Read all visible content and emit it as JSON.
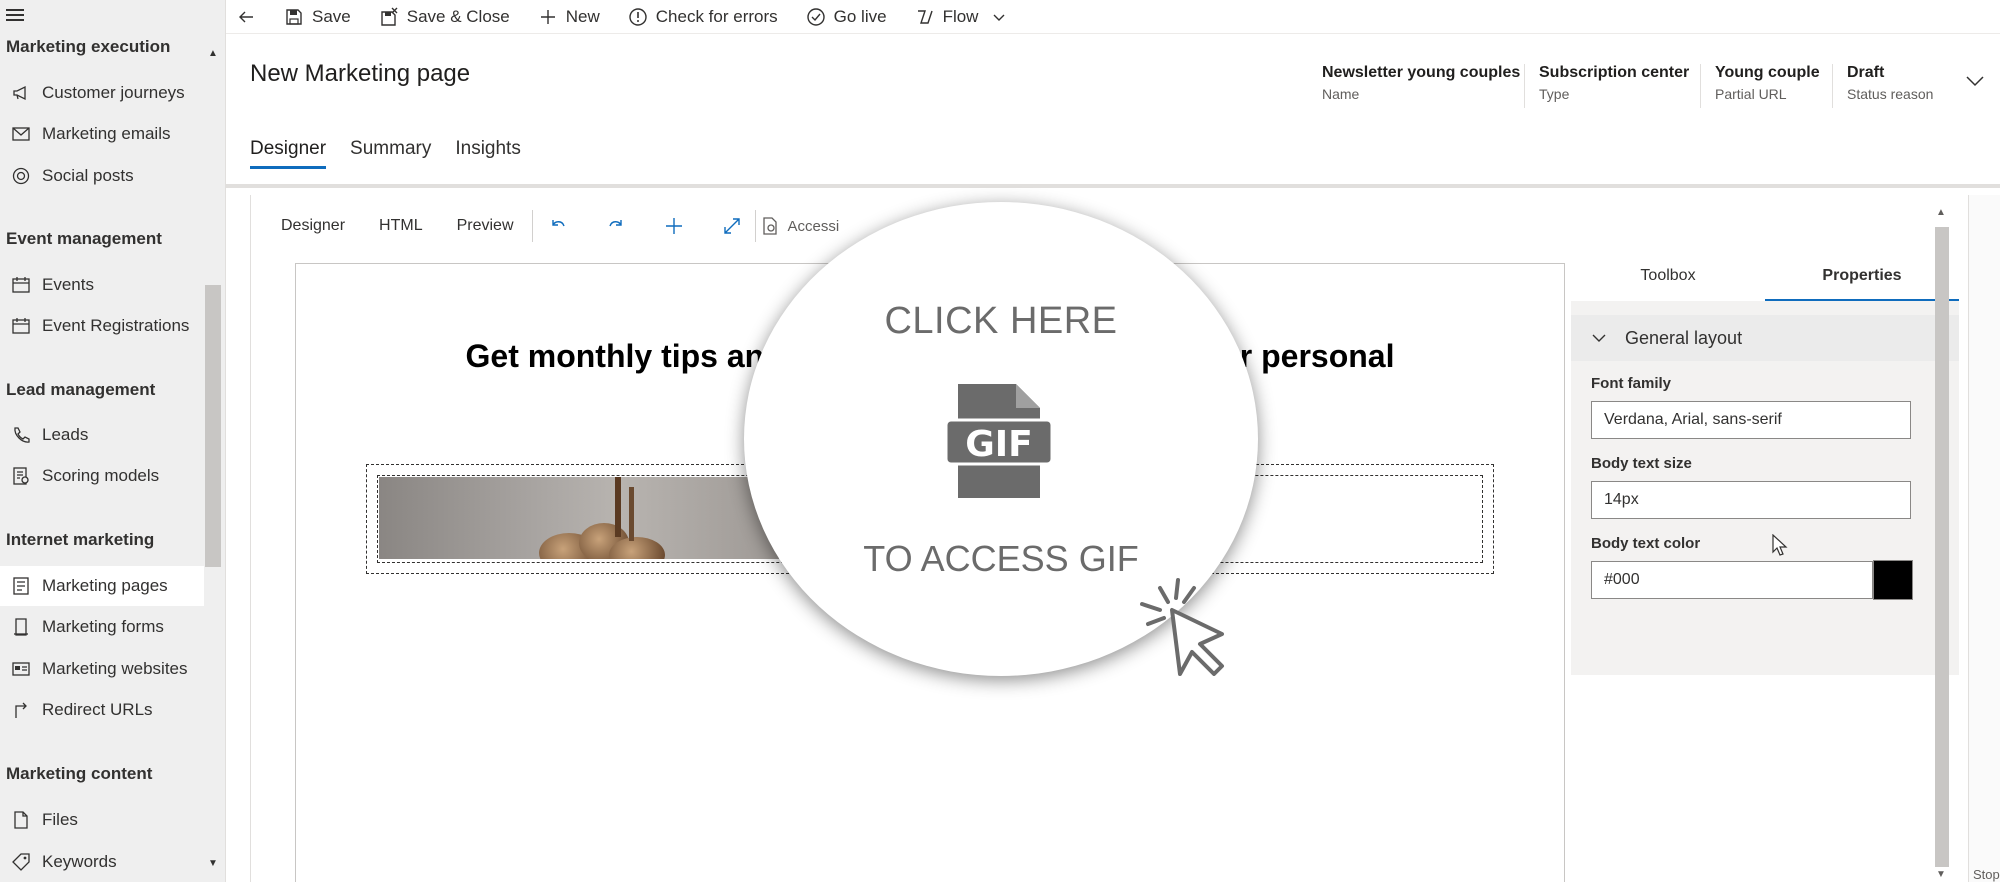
{
  "sidebar": {
    "groups": [
      {
        "title": "Marketing execution"
      },
      {
        "title": "Event management"
      },
      {
        "title": "Lead management"
      },
      {
        "title": "Internet marketing"
      },
      {
        "title": "Marketing content"
      }
    ],
    "items": [
      {
        "label": "Customer journeys",
        "icon": "megaphone-icon"
      },
      {
        "label": "Marketing emails",
        "icon": "mail-icon"
      },
      {
        "label": "Social posts",
        "icon": "social-icon"
      },
      {
        "label": "Events",
        "icon": "calendar-icon"
      },
      {
        "label": "Event Registrations",
        "icon": "calendar-icon"
      },
      {
        "label": "Leads",
        "icon": "phone-icon"
      },
      {
        "label": "Scoring models",
        "icon": "scoring-icon"
      },
      {
        "label": "Marketing pages",
        "icon": "page-icon"
      },
      {
        "label": "Marketing forms",
        "icon": "form-icon"
      },
      {
        "label": "Marketing websites",
        "icon": "website-icon"
      },
      {
        "label": "Redirect URLs",
        "icon": "redirect-icon"
      },
      {
        "label": "Files",
        "icon": "file-icon"
      },
      {
        "label": "Keywords",
        "icon": "tag-icon"
      }
    ]
  },
  "commandbar": {
    "save": "Save",
    "save_close": "Save & Close",
    "new": "New",
    "check_errors": "Check for errors",
    "go_live": "Go live",
    "flow": "Flow"
  },
  "header": {
    "title": "New Marketing page",
    "fields": [
      {
        "value": "Newsletter young couples",
        "label": "Name"
      },
      {
        "value": "Subscription center",
        "label": "Type"
      },
      {
        "value": "Young couple",
        "label": "Partial URL"
      },
      {
        "value": "Draft",
        "label": "Status reason"
      }
    ],
    "tabs": [
      "Designer",
      "Summary",
      "Insights"
    ]
  },
  "designer": {
    "tabs": [
      "Designer",
      "HTML",
      "Preview"
    ],
    "accessibility_label": "Accessi",
    "heading_left": "Get monthly tips an",
    "heading_right": "ur personal"
  },
  "properties": {
    "tabs": [
      "Toolbox",
      "Properties"
    ],
    "section": "General layout",
    "font_family_label": "Font family",
    "font_family_value": "Verdana, Arial, sans-serif",
    "body_size_label": "Body text size",
    "body_size_value": "14px",
    "body_color_label": "Body text color",
    "body_color_value": "#000"
  },
  "overlay": {
    "top_text": "CLICK HERE",
    "bottom_text": "TO ACCESS GIF",
    "file_label": "GIF"
  },
  "edge_stub": "Stop",
  "colors": {
    "accent": "#0f6cbd",
    "sidebar_bg": "#efefef",
    "swatch": "#000000"
  }
}
